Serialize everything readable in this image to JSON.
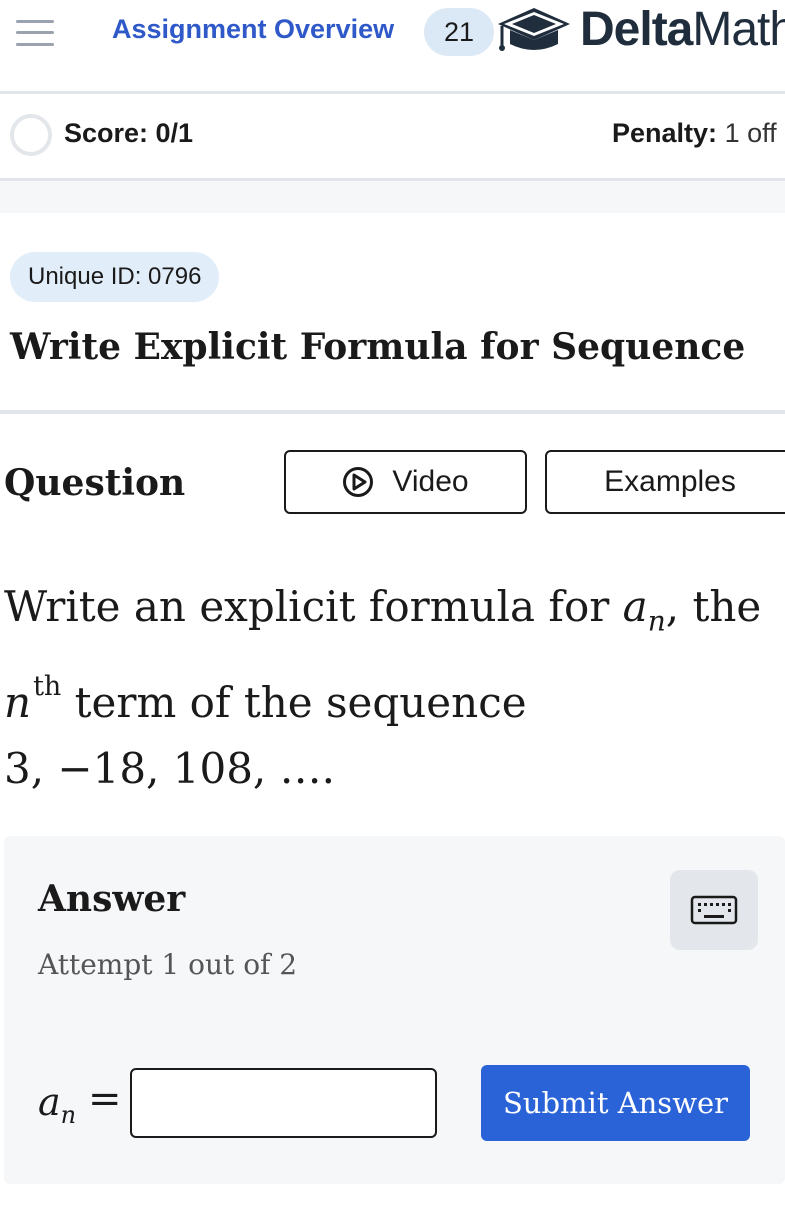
{
  "header": {
    "nav_link": "Assignment Overview",
    "badge_count": "21",
    "logo_bold": "Delta",
    "logo_light": "Math"
  },
  "score": {
    "label": "Score: 0/1",
    "penalty_label": "Penalty:",
    "penalty_value": "1 off"
  },
  "problem": {
    "unique_id": "Unique ID: 0796",
    "title": "Write Explicit Formula for Sequence",
    "question_label": "Question",
    "video_label": "Video",
    "examples_label": "Examples",
    "prompt_part1": "Write an explicit formula for ",
    "prompt_var": "a",
    "prompt_sub": "n",
    "prompt_part2": ", the",
    "prompt_n": "n",
    "prompt_sup": "th",
    "prompt_part3": " term of the sequence",
    "sequence": "3, −18, 108, …."
  },
  "answer": {
    "label": "Answer",
    "attempt": "Attempt 1 out of 2",
    "var": "a",
    "var_sub": "n",
    "equals": "=",
    "input_value": "",
    "submit_label": "Submit Answer"
  },
  "colors": {
    "primary": "#2a63d8",
    "link": "#2f59c9",
    "badge_bg": "#dbe8f6",
    "panel_bg": "#f6f7f9"
  },
  "icons": [
    "menu-icon",
    "graduation-cap-icon",
    "play-circle-icon",
    "keyboard-icon"
  ]
}
